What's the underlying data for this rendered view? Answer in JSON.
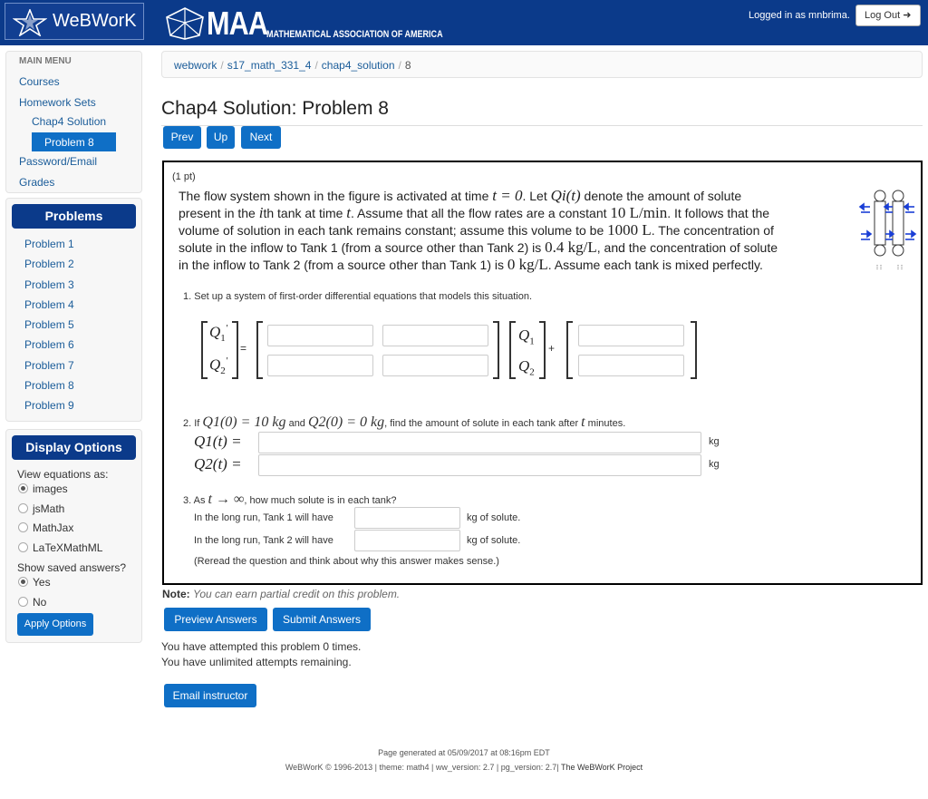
{
  "header": {
    "app_name": "WeBWorK",
    "maa_big": "MAA",
    "maa_sub": "MATHEMATICAL ASSOCIATION OF AMERICA",
    "logged_in": "Logged in as mnbrima.",
    "logout": "Log Out"
  },
  "sidebar": {
    "main_menu": "MAIN MENU",
    "links": [
      "Courses",
      "Homework Sets",
      "Chap4 Solution",
      "Problem 8",
      "Password/Email",
      "Grades"
    ],
    "problems_header": "Problems",
    "problems": [
      "Problem 1",
      "Problem 2",
      "Problem 3",
      "Problem 4",
      "Problem 5",
      "Problem 6",
      "Problem 7",
      "Problem 8",
      "Problem 9"
    ],
    "display_header": "Display Options",
    "view_label": "View equations as:",
    "view_options": [
      "images",
      "jsMath",
      "MathJax",
      "LaTeXMathML"
    ],
    "view_selected": "images",
    "saved_label": "Show saved answers?",
    "saved_options": [
      "Yes",
      "No"
    ],
    "apply": "Apply Options"
  },
  "breadcrumb": [
    "webwork",
    "s17_math_331_4",
    "chap4_solution",
    "8"
  ],
  "page_title": "Chap4 Solution: Problem 8",
  "nav": {
    "prev": "Prev",
    "up": "Up",
    "next": "Next"
  },
  "problem": {
    "points": "(1 pt)",
    "para_lines": [
      [
        "The flow system shown in the figure is activated at time ",
        "t = 0",
        ". Let ",
        "Qi(t)",
        " denote the amount of solute"
      ],
      [
        "present in the ",
        "i",
        "th tank at time ",
        "t",
        ". Assume that all the flow rates are a constant ",
        "10 L/min",
        ". It follows that the"
      ],
      [
        "volume of solution in each tank remains constant; assume this volume to be ",
        "1000 L",
        ". The concentration of"
      ],
      [
        "solute in the inflow to Tank 1 (from a source other than Tank 2) is ",
        "0.4 kg/L",
        ", and the concentration of solute"
      ],
      [
        "in the inflow to Tank 2 (from a source other than Tank 1) is ",
        "0 kg/L",
        ". Assume each tank is mixed perfectly."
      ]
    ],
    "part1": "1. Set up a system of first-order differential equations that models this situation.",
    "part2_pre": "2. If ",
    "part2_m1": "Q1(0) = 10 kg",
    "part2_and": " and ",
    "part2_m2": "Q2(0) = 0 kg",
    "part2_post": ", find the amount of solute in each tank after ",
    "part2_t": "t",
    "part2_end": " minutes.",
    "q1t": "Q1(t) =",
    "q2t": "Q2(t) =",
    "unit": "kg",
    "part3_pre": "3. As ",
    "part3_m": "t → ∞",
    "part3_post": ", how much solute is in each tank?",
    "tank1_pre": "In the long run, Tank 1 will have",
    "tank2_pre": "In the long run, Tank 2 will have",
    "solute_post": "kg of solute.",
    "reread": "(Reread the question and think about why this answer makes sense.)"
  },
  "note_label": "Note:",
  "note_text": "You can earn partial credit on this problem.",
  "buttons": {
    "preview": "Preview Answers",
    "submit": "Submit Answers",
    "email": "Email instructor"
  },
  "attempts": [
    "You have attempted this problem 0 times.",
    "You have unlimited attempts remaining."
  ],
  "footer": {
    "generated": "Page generated at 05/09/2017 at 08:16pm EDT",
    "copyright": "WeBWorK © 1996-2013 | theme: math4 | ww_version: 2.7 | pg_version: 2.7| ",
    "project": "The WeBWorK Project"
  }
}
